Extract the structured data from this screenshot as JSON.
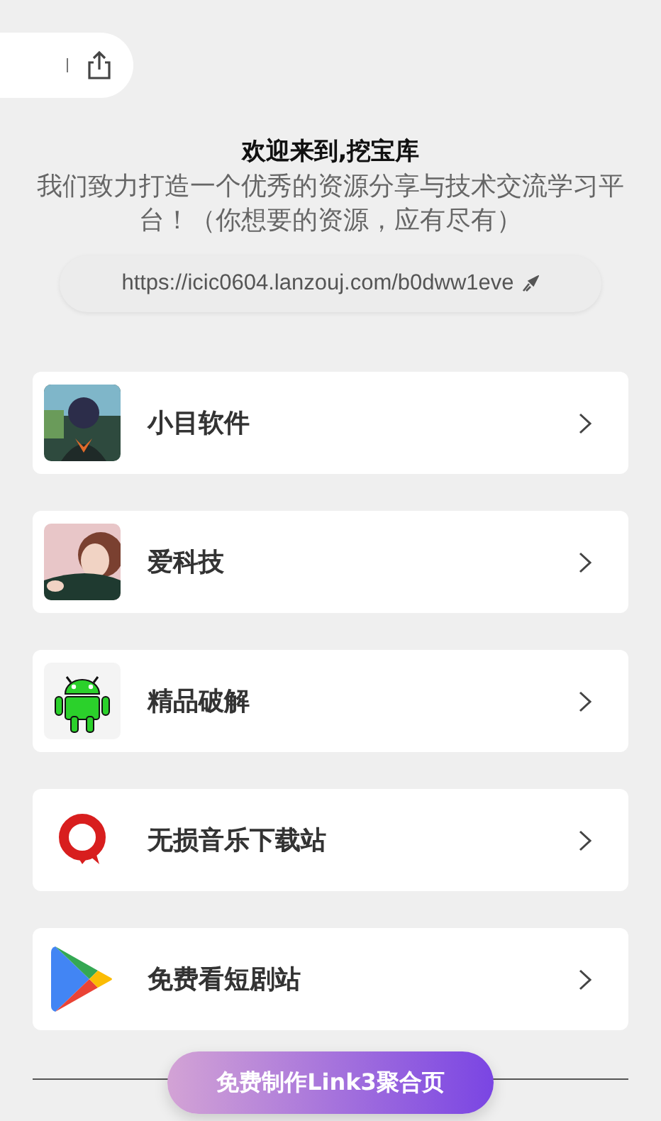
{
  "header": {
    "title": "欢迎来到,挖宝库",
    "subtitle": "我们致力打造一个优秀的资源分享与技术交流学习平台！（你想要的资源，应有尽有）",
    "url": "https://icic0604.lanzouj.com/b0dww1eve"
  },
  "links": [
    {
      "label": "小目软件",
      "kind": "picture"
    },
    {
      "label": "爱科技",
      "kind": "picture"
    },
    {
      "label": "精品破解",
      "kind": "android"
    },
    {
      "label": "无损音乐下载站",
      "kind": "q-logo"
    },
    {
      "label": "免费看短剧站",
      "kind": "play"
    }
  ],
  "cta": {
    "label": "免费制作Link3聚合页"
  }
}
